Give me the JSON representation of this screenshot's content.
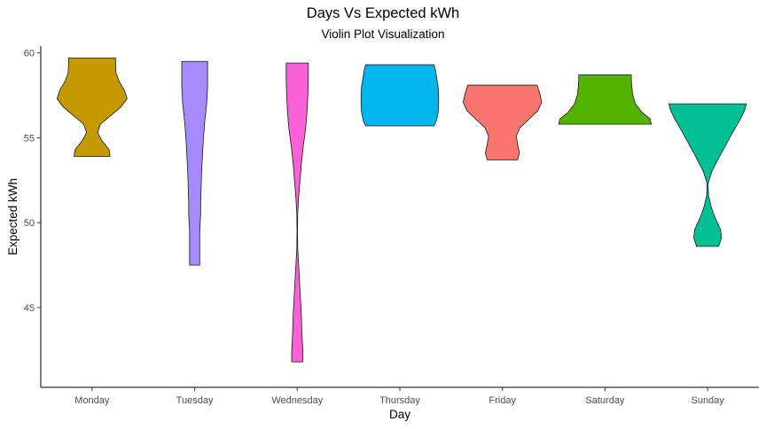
{
  "chart_data": {
    "type": "violin",
    "title": "Days Vs Expected kWh",
    "subtitle": "Violin Plot Visualization",
    "xlabel": "Day",
    "ylabel": "Expected kWh",
    "ylim": [
      40.3,
      60.4
    ],
    "yticks": [
      45,
      50,
      55,
      60
    ],
    "grid": false,
    "legend": "none",
    "categories": [
      "Monday",
      "Tuesday",
      "Wednesday",
      "Thursday",
      "Friday",
      "Saturday",
      "Sunday"
    ],
    "violins": [
      {
        "category": "Monday",
        "color": "#C49A00",
        "min": 53.9,
        "max": 59.7,
        "profile": [
          [
            53.9,
            0.39
          ],
          [
            54.3,
            0.37
          ],
          [
            54.8,
            0.22
          ],
          [
            55.3,
            0.12
          ],
          [
            55.8,
            0.18
          ],
          [
            56.3,
            0.4
          ],
          [
            56.8,
            0.62
          ],
          [
            57.3,
            0.76
          ],
          [
            57.8,
            0.7
          ],
          [
            58.3,
            0.59
          ],
          [
            58.8,
            0.52
          ],
          [
            59.3,
            0.51
          ],
          [
            59.7,
            0.51
          ]
        ]
      },
      {
        "category": "Tuesday",
        "color": "#A58AFF",
        "min": 47.5,
        "max": 59.5,
        "profile": [
          [
            47.5,
            0.11
          ],
          [
            48.5,
            0.11
          ],
          [
            49.5,
            0.11
          ],
          [
            50.5,
            0.13
          ],
          [
            51.2,
            0.13
          ],
          [
            52.0,
            0.14
          ],
          [
            53.0,
            0.15
          ],
          [
            54.0,
            0.17
          ],
          [
            55.0,
            0.19
          ],
          [
            56.0,
            0.22
          ],
          [
            57.0,
            0.26
          ],
          [
            58.0,
            0.28
          ],
          [
            59.0,
            0.28
          ],
          [
            59.5,
            0.28
          ]
        ]
      },
      {
        "category": "Wednesday",
        "color": "#FB61D7",
        "min": 41.8,
        "max": 59.4,
        "profile": [
          [
            41.8,
            0.12
          ],
          [
            42.5,
            0.12
          ],
          [
            43.5,
            0.1
          ],
          [
            44.5,
            0.09
          ],
          [
            45.5,
            0.07
          ],
          [
            46.5,
            0.05
          ],
          [
            47.5,
            0.03
          ],
          [
            48.5,
            0.01
          ],
          [
            49.5,
            0.005
          ],
          [
            50.5,
            0.01
          ],
          [
            51.5,
            0.03
          ],
          [
            52.5,
            0.06
          ],
          [
            53.5,
            0.09
          ],
          [
            54.5,
            0.13
          ],
          [
            55.5,
            0.18
          ],
          [
            56.5,
            0.21
          ],
          [
            57.5,
            0.23
          ],
          [
            58.5,
            0.24
          ],
          [
            59.4,
            0.24
          ]
        ]
      },
      {
        "category": "Thursday",
        "color": "#00B6EB",
        "min": 55.7,
        "max": 59.3,
        "profile": [
          [
            55.7,
            0.74
          ],
          [
            56.0,
            0.79
          ],
          [
            56.5,
            0.83
          ],
          [
            57.0,
            0.84
          ],
          [
            57.5,
            0.84
          ],
          [
            58.0,
            0.83
          ],
          [
            58.5,
            0.8
          ],
          [
            59.0,
            0.77
          ],
          [
            59.3,
            0.74
          ]
        ]
      },
      {
        "category": "Friday",
        "color": "#F8766D",
        "min": 53.7,
        "max": 58.1,
        "profile": [
          [
            53.7,
            0.33
          ],
          [
            54.1,
            0.37
          ],
          [
            54.6,
            0.33
          ],
          [
            55.1,
            0.3
          ],
          [
            55.6,
            0.38
          ],
          [
            56.1,
            0.58
          ],
          [
            56.6,
            0.77
          ],
          [
            57.1,
            0.85
          ],
          [
            57.6,
            0.81
          ],
          [
            58.1,
            0.75
          ]
        ]
      },
      {
        "category": "Saturday",
        "color": "#53B400",
        "min": 55.8,
        "max": 58.7,
        "profile": [
          [
            55.8,
            1.0
          ],
          [
            56.1,
            0.98
          ],
          [
            56.5,
            0.8
          ],
          [
            57.0,
            0.66
          ],
          [
            57.5,
            0.6
          ],
          [
            58.0,
            0.58
          ],
          [
            58.4,
            0.57
          ],
          [
            58.7,
            0.57
          ]
        ]
      },
      {
        "category": "Sunday",
        "color": "#00C094",
        "min": 48.6,
        "max": 57.0,
        "profile": [
          [
            48.6,
            0.24
          ],
          [
            49.1,
            0.3
          ],
          [
            49.6,
            0.28
          ],
          [
            50.3,
            0.16
          ],
          [
            50.9,
            0.08
          ],
          [
            51.6,
            0.02
          ],
          [
            52.3,
            0.01
          ],
          [
            53.0,
            0.09
          ],
          [
            53.8,
            0.24
          ],
          [
            54.6,
            0.4
          ],
          [
            55.4,
            0.56
          ],
          [
            56.1,
            0.71
          ],
          [
            56.6,
            0.8
          ],
          [
            57.0,
            0.84
          ]
        ]
      }
    ]
  }
}
